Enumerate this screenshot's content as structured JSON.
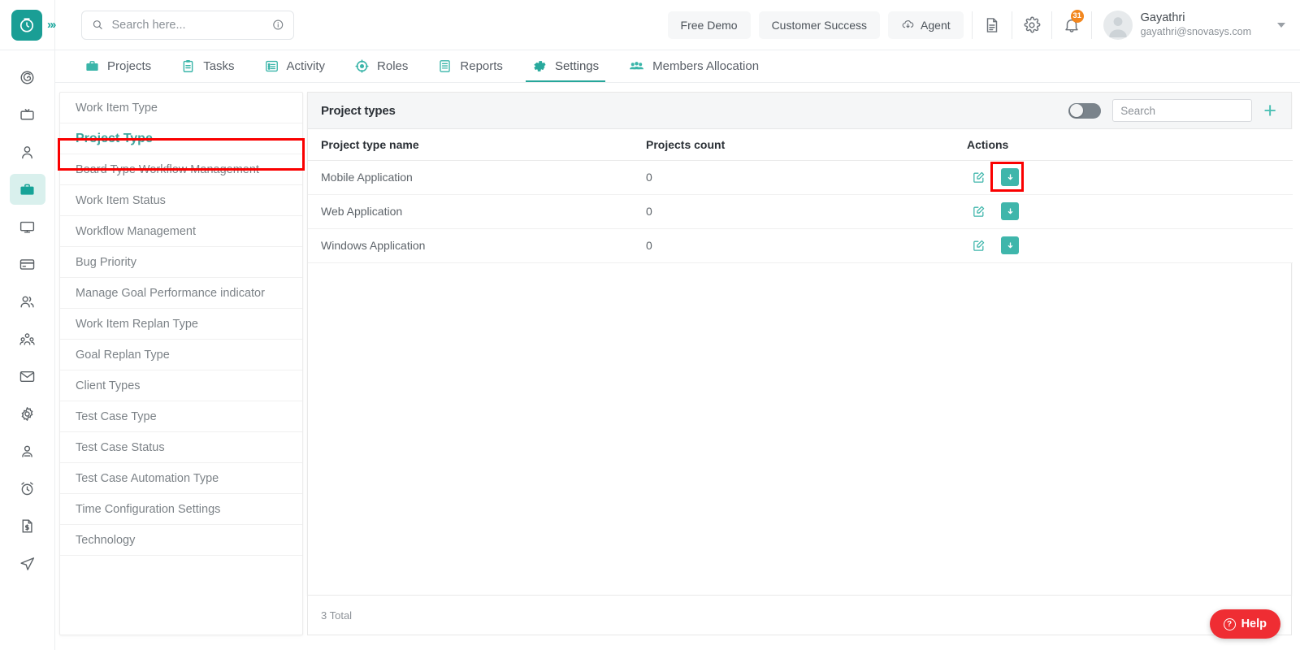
{
  "header": {
    "logo_icon": "clock-logo-icon",
    "expand_icon": "chevron-double-right-icon",
    "search": {
      "placeholder": "Search here...",
      "value": "",
      "icon": "search-icon",
      "info_icon": "info-circle-icon"
    },
    "buttons": [
      {
        "label": "Free Demo",
        "name": "free-demo-button"
      },
      {
        "label": "Customer Success",
        "name": "customer-success-button"
      },
      {
        "label": "Agent",
        "name": "agent-button",
        "icon": "cloud-download-icon"
      }
    ],
    "icons": [
      {
        "name": "document-icon"
      },
      {
        "name": "gear-icon"
      },
      {
        "name": "bell-icon",
        "badge": "31"
      }
    ],
    "user": {
      "name": "Gayathri",
      "email": "gayathri@snovasys.com",
      "avatar_icon": "user-avatar-icon",
      "caret_icon": "chevron-down-icon"
    }
  },
  "nav": {
    "tabs": [
      {
        "label": "Projects",
        "icon": "briefcase-icon",
        "active": false
      },
      {
        "label": "Tasks",
        "icon": "clipboard-icon",
        "active": false
      },
      {
        "label": "Activity",
        "icon": "list-box-icon",
        "active": false
      },
      {
        "label": "Roles",
        "icon": "target-gear-icon",
        "active": false
      },
      {
        "label": "Reports",
        "icon": "report-lines-icon",
        "active": false
      },
      {
        "label": "Settings",
        "icon": "settings-gear-icon",
        "active": true
      },
      {
        "label": "Members Allocation",
        "icon": "people-group-icon",
        "active": false
      }
    ]
  },
  "rail": {
    "items": [
      {
        "name": "rail-item-dashboard",
        "icon": "spiral-icon",
        "active": false
      },
      {
        "name": "rail-item-board",
        "icon": "tv-board-icon",
        "active": false
      },
      {
        "name": "rail-item-profile",
        "icon": "person-icon",
        "active": false
      },
      {
        "name": "rail-item-projects",
        "icon": "briefcase-icon",
        "active": true
      },
      {
        "name": "rail-item-monitor",
        "icon": "monitor-icon",
        "active": false
      },
      {
        "name": "rail-item-billing",
        "icon": "credit-card-icon",
        "active": false
      },
      {
        "name": "rail-item-team",
        "icon": "two-people-icon",
        "active": false
      },
      {
        "name": "rail-item-organization",
        "icon": "org-group-icon",
        "active": false
      },
      {
        "name": "rail-item-mail",
        "icon": "envelope-icon",
        "active": false
      },
      {
        "name": "rail-item-settings",
        "icon": "gear-icon",
        "active": false
      },
      {
        "name": "rail-item-account",
        "icon": "user-badge-icon",
        "active": false
      },
      {
        "name": "rail-item-timer",
        "icon": "alarm-clock-icon",
        "active": false
      },
      {
        "name": "rail-item-invoice",
        "icon": "invoice-icon",
        "active": false
      },
      {
        "name": "rail-item-send",
        "icon": "paper-plane-icon",
        "active": false
      }
    ]
  },
  "settings_menu": {
    "items": [
      {
        "label": "Work Item Type",
        "selected": false
      },
      {
        "label": "Project Type",
        "selected": true
      },
      {
        "label": "Board Type Workflow Management",
        "selected": false
      },
      {
        "label": "Work Item Status",
        "selected": false
      },
      {
        "label": "Workflow Management",
        "selected": false
      },
      {
        "label": "Bug Priority",
        "selected": false
      },
      {
        "label": "Manage Goal Performance indicator",
        "selected": false
      },
      {
        "label": "Work Item Replan Type",
        "selected": false
      },
      {
        "label": "Goal Replan Type",
        "selected": false
      },
      {
        "label": "Client Types",
        "selected": false
      },
      {
        "label": "Test Case Type",
        "selected": false
      },
      {
        "label": "Test Case Status",
        "selected": false
      },
      {
        "label": "Test Case Automation Type",
        "selected": false
      },
      {
        "label": "Time Configuration Settings",
        "selected": false
      },
      {
        "label": "Technology",
        "selected": false
      }
    ]
  },
  "panel": {
    "title": "Project types",
    "toggle": {
      "name": "archived-toggle",
      "on": false
    },
    "search": {
      "placeholder": "Search",
      "value": ""
    },
    "add_label": "+",
    "columns": [
      "Project type name",
      "Projects count",
      "Actions"
    ],
    "rows": [
      {
        "name": "Mobile Application",
        "count": "0",
        "edit_icon": "edit-pencil-icon",
        "archive_icon": "archive-download-icon"
      },
      {
        "name": "Web Application",
        "count": "0",
        "edit_icon": "edit-pencil-icon",
        "archive_icon": "archive-download-icon"
      },
      {
        "name": "Windows Application",
        "count": "0",
        "edit_icon": "edit-pencil-icon",
        "archive_icon": "archive-download-icon"
      }
    ],
    "total_label": "3 Total"
  },
  "help": {
    "label": "Help",
    "icon": "question-circle-icon"
  },
  "colors": {
    "brand_teal": "#1a9e95",
    "accent_teal": "#3fb6ab",
    "highlight_red": "#fa0000",
    "badge_orange": "#f2871f",
    "help_red": "#ef2d33"
  }
}
